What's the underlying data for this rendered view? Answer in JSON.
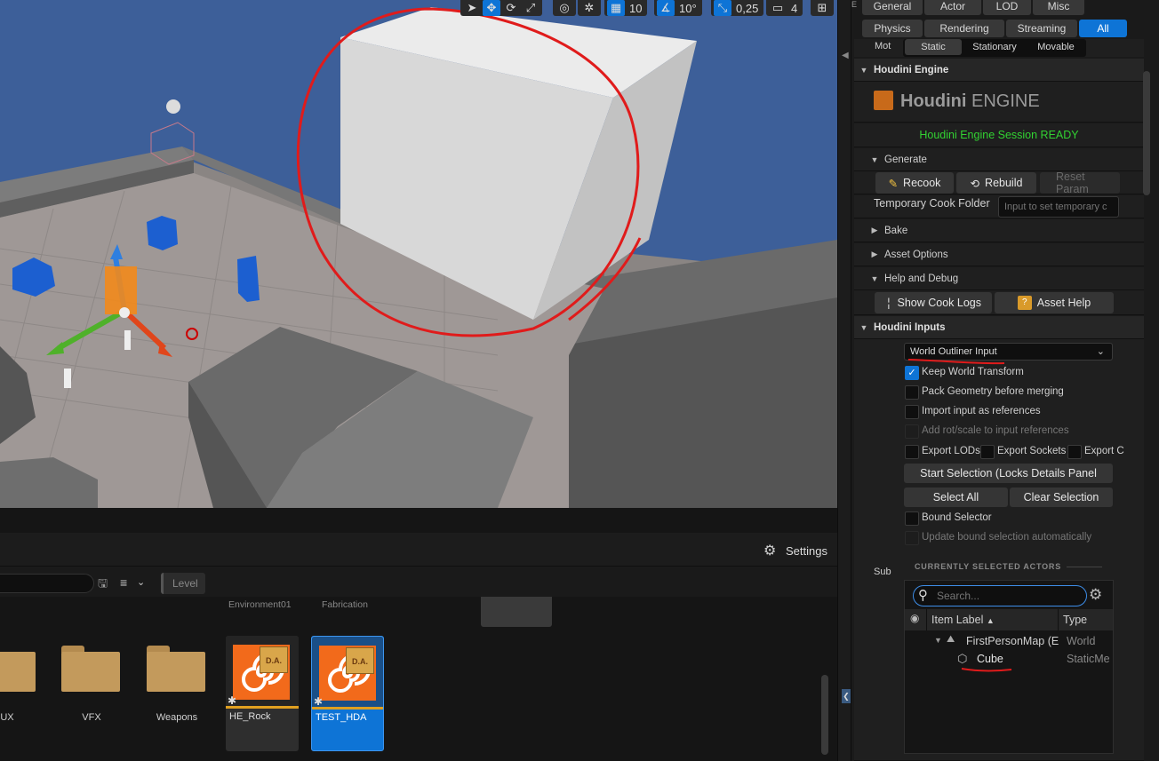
{
  "viewport": {
    "toolbar": {
      "grid_snap": "10",
      "rotation_snap": "10°",
      "scale_snap": "0,25",
      "camera_speed": "4"
    }
  },
  "filters": {
    "row1": [
      "General",
      "Actor",
      "LOD",
      "Misc"
    ],
    "row2": [
      "Physics",
      "Rendering",
      "Streaming",
      "All"
    ],
    "selected": "All"
  },
  "mobility": {
    "label": "Mot",
    "options": [
      "Static",
      "Stationary",
      "Movable"
    ],
    "selected": "Static"
  },
  "houdini_engine": {
    "section_title": "Houdini Engine",
    "logo_text_a": "Houdini",
    "logo_text_b": "ENGINE",
    "session_status": "Houdini Engine Session READY",
    "session_color": "#32d232",
    "generate": {
      "label": "Generate",
      "recook": "Recook",
      "rebuild": "Rebuild",
      "reset_params": "Reset Param"
    },
    "temp_cook_folder": {
      "label": "Temporary Cook Folder",
      "placeholder": "Input to set temporary c"
    },
    "bake": "Bake",
    "asset_options": "Asset Options",
    "help_debug": {
      "label": "Help and Debug",
      "show_cook_logs": "Show Cook Logs",
      "asset_help": "Asset Help"
    }
  },
  "houdini_inputs": {
    "section_title": "Houdini Inputs",
    "input_type": "World Outliner Input",
    "keep_world_transform": "Keep World Transform",
    "pack_geometry": "Pack Geometry before merging",
    "import_refs": "Import input as references",
    "add_rot_scale": "Add rot/scale to input references",
    "export_lods": "Export LODs",
    "export_sockets": "Export Sockets",
    "export_c": "Export C",
    "start_selection": "Start Selection (Locks Details Panel",
    "select_all": "Select All",
    "clear_selection": "Clear Selection",
    "bound_selector": "Bound Selector",
    "update_bound": "Update bound selection automatically",
    "sub_label": "Sub",
    "currently_selected": "CURRENTLY SELECTED ACTORS",
    "search_placeholder": "Search...",
    "col_item_label": "Item Label",
    "col_type": "Type",
    "tree": [
      {
        "label": "FirstPersonMap (E",
        "type": "World"
      },
      {
        "label": "Cube",
        "type": "StaticMe"
      }
    ]
  },
  "content_browser": {
    "settings": "Settings",
    "level_chip": "Level",
    "top_labels": [
      "Environment01",
      "Fabrication"
    ],
    "folders": [
      "UX",
      "VFX",
      "Weapons"
    ],
    "assets": [
      {
        "name": "HE_Rock",
        "badge": "D.A."
      },
      {
        "name": "TEST_HDA",
        "badge": "D.A."
      }
    ]
  },
  "colors": {
    "accent": "#0e74d6",
    "annotation": "#e01b1b",
    "asset_orange": "#f26a1b"
  }
}
